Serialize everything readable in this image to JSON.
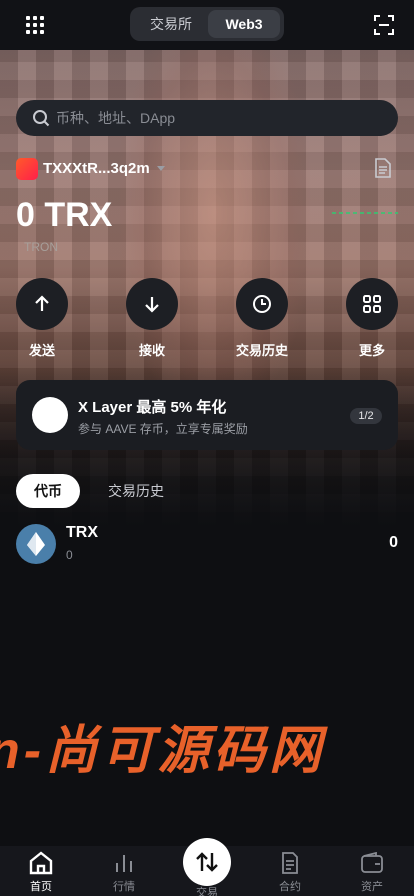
{
  "header": {
    "segments": [
      "交易所",
      "Web3"
    ],
    "active_segment": "Web3"
  },
  "search": {
    "placeholder": "币种、地址、DApp"
  },
  "account": {
    "name": "TXXXtR...3q2m",
    "balance": "0 TRX",
    "chain": "TRON"
  },
  "actions": [
    {
      "label": "发送",
      "icon": "arrow-up-icon"
    },
    {
      "label": "接收",
      "icon": "arrow-down-icon"
    },
    {
      "label": "交易历史",
      "icon": "clock-icon"
    },
    {
      "label": "更多",
      "icon": "grid-icon"
    }
  ],
  "promo": {
    "title": "X Layer 最高 5% 年化",
    "subtitle": "参与 AAVE 存币，立享专属奖励",
    "pager": "1/2"
  },
  "tabs": [
    {
      "label": "代币",
      "active": true
    },
    {
      "label": "交易历史",
      "active": false
    }
  ],
  "tokens": [
    {
      "symbol": "TRX",
      "amount": "0",
      "balance": "0"
    }
  ],
  "watermark": "n-尚可源码网",
  "bottom_nav": [
    {
      "label": "首页",
      "icon": "home-icon",
      "active": true
    },
    {
      "label": "行情",
      "icon": "chart-icon",
      "active": false
    },
    {
      "label": "交易",
      "icon": "swap-icon",
      "active": false
    },
    {
      "label": "合约",
      "icon": "contract-icon",
      "active": false
    },
    {
      "label": "资产",
      "icon": "wallet-icon",
      "active": false
    }
  ],
  "colors": {
    "background": "#0e0f12",
    "accent_watermark": "#e8612a",
    "sparkline": "#2ecc71"
  }
}
